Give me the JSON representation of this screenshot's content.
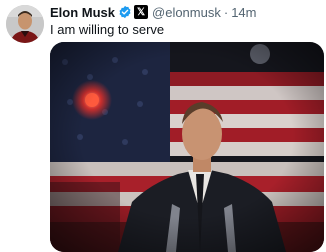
{
  "tweet": {
    "display_name": "Elon Musk",
    "handle": "@elonmusk",
    "separator": "·",
    "timestamp": "14m",
    "text": "I am willing to serve",
    "badge_icon": "x-logo-icon"
  },
  "colors": {
    "verified_blue": "#1d9bf0",
    "secondary_text": "#536471",
    "flag_red": "#b22234"
  }
}
